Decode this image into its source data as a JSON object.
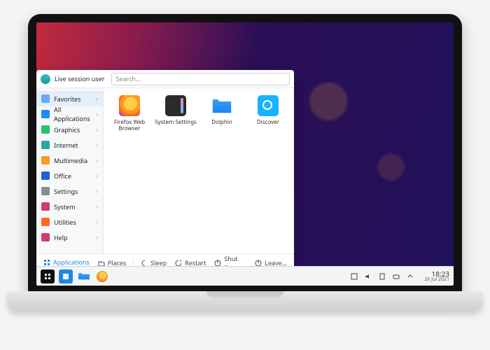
{
  "user_label": "Live session user",
  "search_placeholder": "Search...",
  "sidebar": [
    {
      "label": "Favorites",
      "color": "#6aa8ff",
      "selected": true
    },
    {
      "label": "All Applications",
      "color": "#1e88ff"
    },
    {
      "label": "Graphics",
      "color": "#29c06e"
    },
    {
      "label": "Internet",
      "color": "#2aa8a8"
    },
    {
      "label": "Multimedia",
      "color": "#ff9a1e"
    },
    {
      "label": "Office",
      "color": "#1e62d6"
    },
    {
      "label": "Settings",
      "color": "#8a8d90"
    },
    {
      "label": "System",
      "color": "#d43b6b"
    },
    {
      "label": "Utilities",
      "color": "#ff6a1e"
    },
    {
      "label": "Help",
      "color": "#d43b6b"
    }
  ],
  "apps": [
    {
      "label": "Firefox Web Browser",
      "icon": "fx"
    },
    {
      "label": "System Settings",
      "icon": "ss"
    },
    {
      "label": "Dolphin",
      "icon": "dl"
    },
    {
      "label": "Discover",
      "icon": "dc"
    }
  ],
  "footer_tabs": [
    {
      "label": "Applications",
      "selected": true
    },
    {
      "label": "Places",
      "selected": false
    }
  ],
  "footer_actions": [
    {
      "label": "Sleep"
    },
    {
      "label": "Restart"
    },
    {
      "label": "Shut Down"
    }
  ],
  "footer_leave": "Leave...",
  "clock": {
    "time": "18:23",
    "date": "26 Jul 2021"
  }
}
